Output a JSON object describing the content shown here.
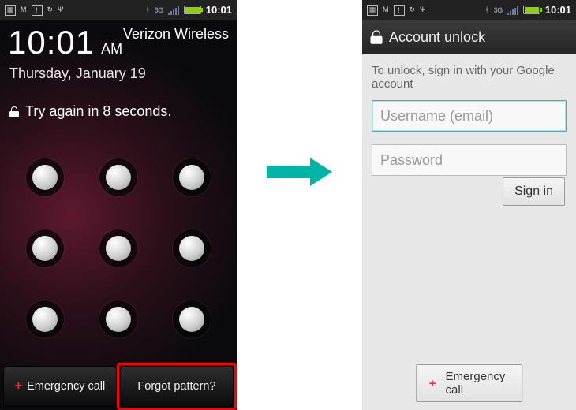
{
  "statusbar": {
    "clock": "10:01",
    "network_type": "3G",
    "icons": [
      "calendar",
      "mail",
      "notification",
      "sync",
      "usb",
      "bluetooth"
    ]
  },
  "lockscreen": {
    "time": "10:01",
    "ampm": "AM",
    "carrier": "Verizon Wireless",
    "date": "Thursday, January 19",
    "retry_message": "Try again in 8 seconds.",
    "emergency_label": "Emergency call",
    "forgot_label": "Forgot pattern?"
  },
  "account_unlock": {
    "title": "Account unlock",
    "hint": "To unlock, sign in with your Google account",
    "username_placeholder": "Username (email)",
    "password_placeholder": "Password",
    "signin_label": "Sign in",
    "emergency_label": "Emergency call"
  }
}
